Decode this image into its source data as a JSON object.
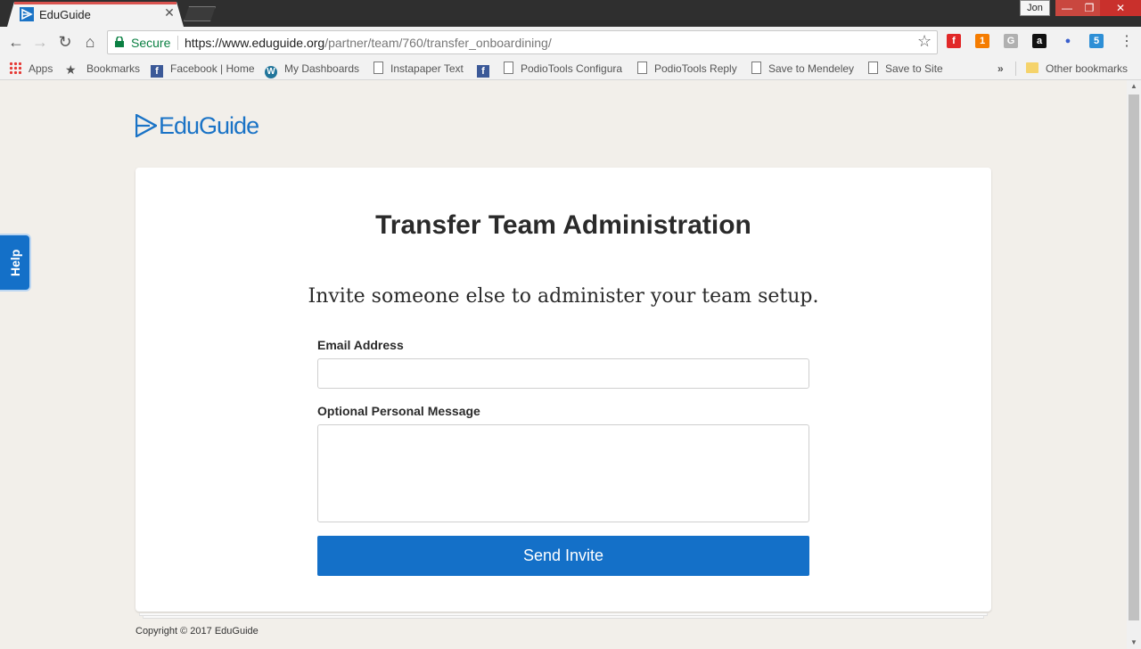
{
  "browser": {
    "tab_title": "EduGuide",
    "tab_close": "✕",
    "user_name": "Jon",
    "window_controls": {
      "minimize": "—",
      "maximize": "❐",
      "close": "✕"
    },
    "secure_label": "Secure",
    "url_host": "https://www.eduguide.org",
    "url_path": "/partner/team/760/transfer_onboardining/",
    "extensions": [
      {
        "icon": "flipboard-icon",
        "label": "f",
        "color": "#e12828"
      },
      {
        "icon": "rss-feed-icon",
        "label": "1",
        "color": "#f57c00"
      },
      {
        "icon": "grammarly-icon",
        "label": "G",
        "color": "#b0b0b0"
      },
      {
        "icon": "amazon-icon",
        "label": "a",
        "color": "#111111"
      },
      {
        "icon": "microphone-icon",
        "label": "🎙",
        "color": "#3a5fcd"
      },
      {
        "icon": "five-icon",
        "label": "5",
        "color": "#2d8fd6"
      }
    ],
    "bookmarks": [
      {
        "label": "Apps",
        "icon": "apps-grid-icon"
      },
      {
        "label": "Bookmarks",
        "icon": "star-icon"
      },
      {
        "label": "Facebook | Home",
        "icon": "facebook-icon"
      },
      {
        "label": "My Dashboards",
        "icon": "wordpress-icon"
      },
      {
        "label": "Instapaper Text",
        "icon": "page-icon"
      },
      {
        "label": "",
        "icon": "facebook-icon"
      },
      {
        "label": "PodioTools Configura",
        "icon": "page-icon"
      },
      {
        "label": "PodioTools Reply",
        "icon": "page-icon"
      },
      {
        "label": "Save to Mendeley",
        "icon": "page-icon"
      },
      {
        "label": "Save to Site",
        "icon": "page-icon"
      }
    ],
    "more_bookmarks": "»",
    "other_bookmarks": "Other bookmarks"
  },
  "page": {
    "logo_text": "EduGuide",
    "title": "Transfer Team Administration",
    "subtitle": "Invite someone else to administer your team setup.",
    "email_label": "Email Address",
    "email_value": "",
    "email_placeholder": "",
    "message_label": "Optional Personal Message",
    "message_value": "",
    "send_label": "Send Invite",
    "copyright": "Copyright © 2017 EduGuide",
    "help_label": "Help"
  },
  "colors": {
    "brand_blue": "#1470c8",
    "page_background": "#f2efea",
    "secure_green": "#0b8043"
  }
}
